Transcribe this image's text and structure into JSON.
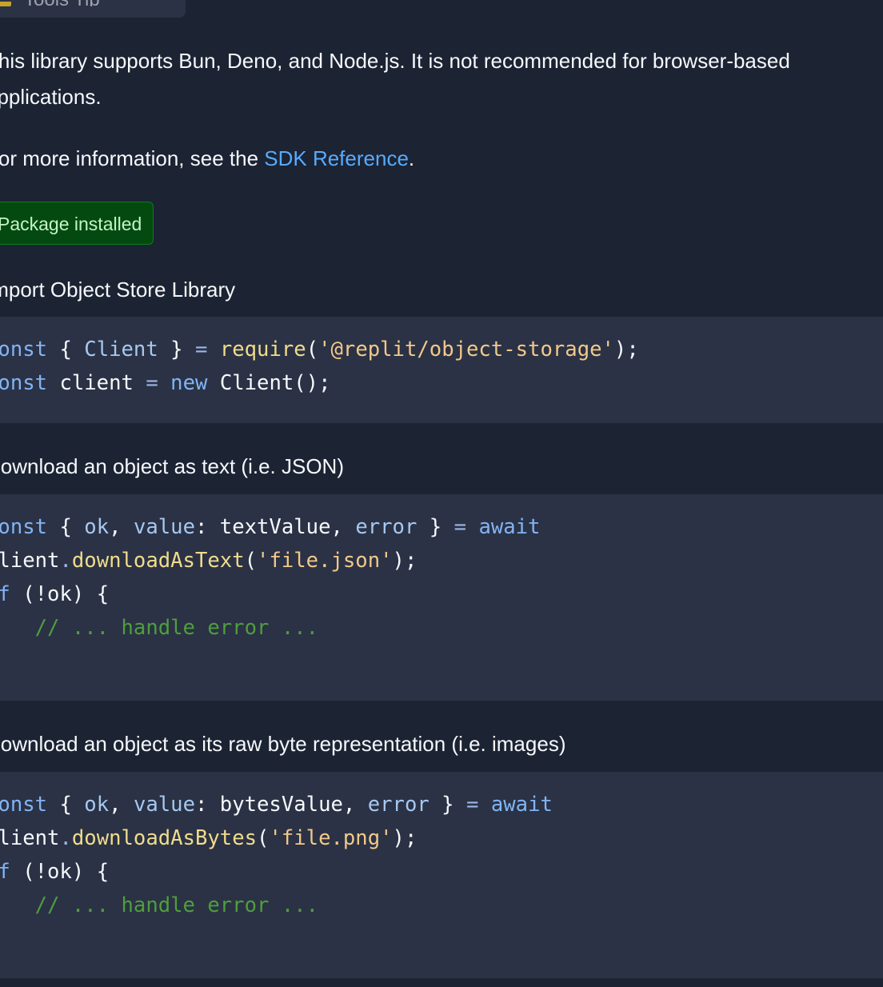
{
  "top_tab": {
    "label": "Tools Tip"
  },
  "intro": {
    "line1": "This library supports Bun, Deno, and Node.js. It is not recommended for browser-based",
    "line2": "applications."
  },
  "reference": {
    "prefix": "For more information, see the ",
    "link": "SDK Reference",
    "suffix": "."
  },
  "badge": {
    "label": "Package installed",
    "icon": "check-icon"
  },
  "sections": [
    {
      "title": "Import Object Store Library",
      "code": [
        [
          {
            "t": "const",
            "c": "kw"
          },
          {
            "t": " { ",
            "c": "punc"
          },
          {
            "t": "Client",
            "c": "prop"
          },
          {
            "t": " } ",
            "c": "punc"
          },
          {
            "t": "=",
            "c": "op"
          },
          {
            "t": " ",
            "c": "punc"
          },
          {
            "t": "require",
            "c": "fn"
          },
          {
            "t": "(",
            "c": "punc"
          },
          {
            "t": "'@replit/object-storage'",
            "c": "str"
          },
          {
            "t": ");",
            "c": "punc"
          }
        ],
        [
          {
            "t": "const",
            "c": "kw"
          },
          {
            "t": " client ",
            "c": "punc"
          },
          {
            "t": "=",
            "c": "op"
          },
          {
            "t": " ",
            "c": "punc"
          },
          {
            "t": "new",
            "c": "kw"
          },
          {
            "t": " Client();",
            "c": "punc"
          }
        ]
      ]
    },
    {
      "title": "Download an object as text (i.e. JSON)",
      "code": [
        [
          {
            "t": "const",
            "c": "kw"
          },
          {
            "t": " { ",
            "c": "punc"
          },
          {
            "t": "ok",
            "c": "prop"
          },
          {
            "t": ", ",
            "c": "punc"
          },
          {
            "t": "value",
            "c": "prop"
          },
          {
            "t": ": textValue, ",
            "c": "punc"
          },
          {
            "t": "error",
            "c": "prop"
          },
          {
            "t": " } ",
            "c": "punc"
          },
          {
            "t": "=",
            "c": "op"
          },
          {
            "t": " ",
            "c": "punc"
          },
          {
            "t": "await",
            "c": "kw"
          }
        ],
        [
          {
            "t": "client",
            "c": "punc"
          },
          {
            "t": ".",
            "c": "op"
          },
          {
            "t": "downloadAsText",
            "c": "fn"
          },
          {
            "t": "(",
            "c": "punc"
          },
          {
            "t": "'file.json'",
            "c": "str"
          },
          {
            "t": ");",
            "c": "punc"
          }
        ],
        [
          {
            "t": "if",
            "c": "kw"
          },
          {
            "t": " (!ok) {",
            "c": "punc"
          }
        ],
        [
          {
            "t": "    ",
            "c": "punc"
          },
          {
            "t": "// ... handle error ...",
            "c": "cm"
          }
        ],
        [
          {
            "t": "}",
            "c": "punc"
          }
        ]
      ]
    },
    {
      "title": "Download an object as its raw byte representation (i.e. images)",
      "code": [
        [
          {
            "t": "const",
            "c": "kw"
          },
          {
            "t": " { ",
            "c": "punc"
          },
          {
            "t": "ok",
            "c": "prop"
          },
          {
            "t": ", ",
            "c": "punc"
          },
          {
            "t": "value",
            "c": "prop"
          },
          {
            "t": ": bytesValue, ",
            "c": "punc"
          },
          {
            "t": "error",
            "c": "prop"
          },
          {
            "t": " } ",
            "c": "punc"
          },
          {
            "t": "=",
            "c": "op"
          },
          {
            "t": " ",
            "c": "punc"
          },
          {
            "t": "await",
            "c": "kw"
          }
        ],
        [
          {
            "t": "client",
            "c": "punc"
          },
          {
            "t": ".",
            "c": "op"
          },
          {
            "t": "downloadAsBytes",
            "c": "fn"
          },
          {
            "t": "(",
            "c": "punc"
          },
          {
            "t": "'file.png'",
            "c": "str"
          },
          {
            "t": ");",
            "c": "punc"
          }
        ],
        [
          {
            "t": "if",
            "c": "kw"
          },
          {
            "t": " (!ok) {",
            "c": "punc"
          }
        ],
        [
          {
            "t": "    ",
            "c": "punc"
          },
          {
            "t": "// ... handle error ...",
            "c": "cm"
          }
        ],
        [
          {
            "t": "}",
            "c": "punc"
          }
        ]
      ]
    }
  ]
}
